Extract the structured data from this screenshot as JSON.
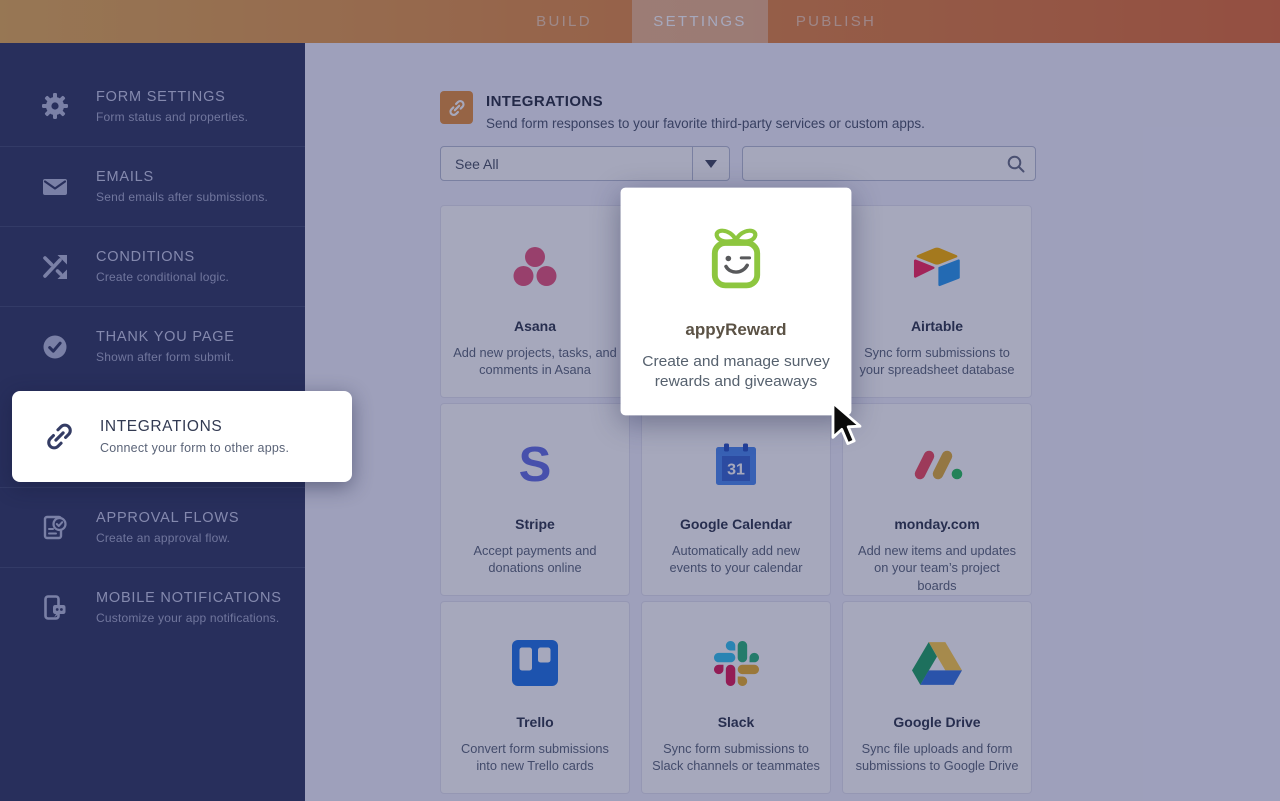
{
  "topbar": {
    "tabs": [
      {
        "label": "BUILD",
        "active": false
      },
      {
        "label": "SETTINGS",
        "active": true
      },
      {
        "label": "PUBLISH",
        "active": false
      }
    ]
  },
  "sidebar": {
    "items": [
      {
        "label": "FORM SETTINGS",
        "description": "Form status and properties.",
        "icon": "gear-icon",
        "active": false
      },
      {
        "label": "EMAILS",
        "description": "Send emails after submissions.",
        "icon": "envelope-icon",
        "active": false
      },
      {
        "label": "CONDITIONS",
        "description": "Create conditional logic.",
        "icon": "crossed-arrows-icon",
        "active": false
      },
      {
        "label": "THANK YOU PAGE",
        "description": "Shown after form submit.",
        "icon": "check-circle-icon",
        "active": false
      },
      {
        "label": "INTEGRATIONS",
        "description": "Connect your form to other apps.",
        "icon": "link-icon",
        "active": true
      },
      {
        "label": "APPROVAL FLOWS",
        "description": "Create an approval flow.",
        "icon": "approval-document-icon",
        "active": false
      },
      {
        "label": "MOBILE NOTIFICATIONS",
        "description": "Customize your app notifications.",
        "icon": "mobile-chat-icon",
        "active": false
      }
    ]
  },
  "main": {
    "header": {
      "title": "INTEGRATIONS",
      "subtitle": "Send form responses to your favorite third-party services or custom apps.",
      "icon": "link-icon"
    },
    "filter": {
      "dropdown_value": "See All",
      "search_placeholder": ""
    },
    "calendar_day": "31",
    "stripe_letter": "S",
    "cards": [
      {
        "title": "Asana",
        "description": "Add new projects, tasks, and comments in Asana",
        "icon": "asana-logo",
        "hovered": false
      },
      {
        "title": "appyReward",
        "description": "Create and manage survey rewards and giveaways",
        "icon": "appyreward-logo",
        "hovered": true
      },
      {
        "title": "Airtable",
        "description": "Sync form submissions to your spreadsheet database",
        "icon": "airtable-logo",
        "hovered": false
      },
      {
        "title": "Stripe",
        "description": "Accept payments and donations online",
        "icon": "stripe-logo",
        "hovered": false
      },
      {
        "title": "Google Calendar",
        "description": "Automatically add new events to your calendar",
        "icon": "google-calendar-logo",
        "hovered": false
      },
      {
        "title": "monday.com",
        "description": "Add new items and updates on your team’s project boards",
        "icon": "monday-logo",
        "hovered": false
      },
      {
        "title": "Trello",
        "description": "Convert form submissions into new Trello cards",
        "icon": "trello-logo",
        "hovered": false
      },
      {
        "title": "Slack",
        "description": "Sync form submissions to Slack channels or teammates",
        "icon": "slack-logo",
        "hovered": false
      },
      {
        "title": "Google Drive",
        "description": "Sync file uploads and form submissions to Google Drive",
        "icon": "google-drive-logo",
        "hovered": false
      }
    ]
  },
  "colors": {
    "topbar_gradient_left": "#e7b058",
    "topbar_gradient_right": "#e2703a",
    "sidebar_bg": "#343c64",
    "page_bg": "#f3f3fe",
    "header_icon_bg": "#e6923f",
    "appyreward_green": "#8dc63f",
    "dim_overlay": "rgba(20,25,80,0.38)"
  }
}
